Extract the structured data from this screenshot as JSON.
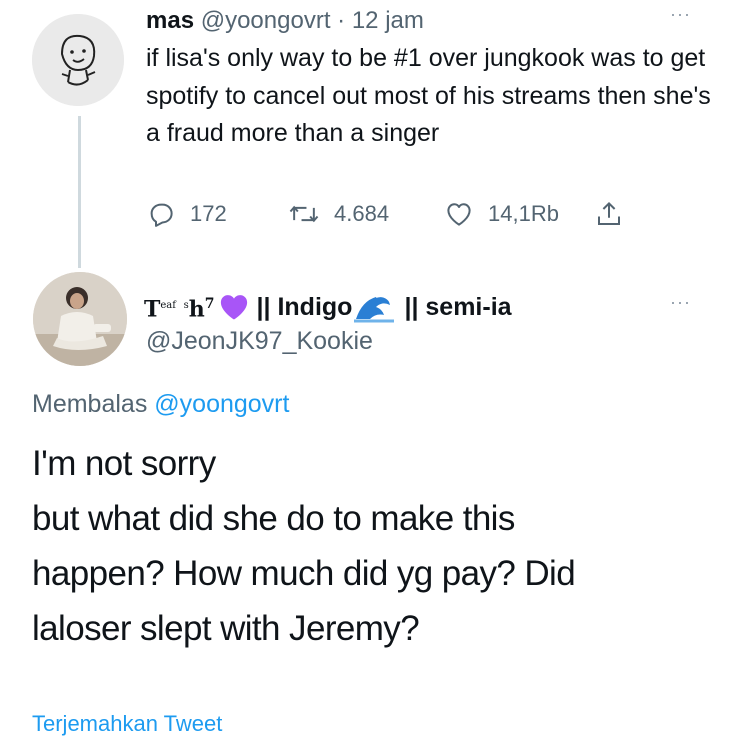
{
  "tweet1": {
    "display_name": "mas",
    "handle": "@yoongovrt",
    "separator": "·",
    "time": "12 jam",
    "more_icon": "···",
    "text": "if lisa's only way to be #1 over jungkook was to get spotify to cancel out most of his streams then she's a fraud more than a singer",
    "actions": {
      "replies": "172",
      "retweets": "4.684",
      "likes": "14,1Rb"
    }
  },
  "tweet2": {
    "name_prefix_main": "T",
    "name_prefix_sup1": "ea",
    "name_prefix_mid": "f",
    "name_prefix_sup2": "s",
    "name_prefix_end": "h",
    "name_prefix_sup3": "7",
    "name_part1": "|| Indigo",
    "name_part2": "|| semi-ia",
    "handle": "@JeonJK97_Kookie",
    "more_icon": "···",
    "reply_label": "Membalas",
    "reply_to": "@yoongovrt",
    "text_lines": [
      "I'm not sorry",
      "but what did she do to make this",
      "happen? How much did yg pay? Did",
      "laloser slept with Jeremy?"
    ]
  },
  "footer": {
    "link_text": "Terjemahkan Tweet"
  },
  "colors": {
    "accent": "#1d9bf0",
    "muted": "#536471",
    "heart": "#a855f7",
    "thread": "#cfd9de"
  },
  "icons": [
    "reply-icon",
    "retweet-icon",
    "like-icon",
    "share-icon",
    "purple-heart-icon",
    "wave-icon",
    "more-icon"
  ]
}
